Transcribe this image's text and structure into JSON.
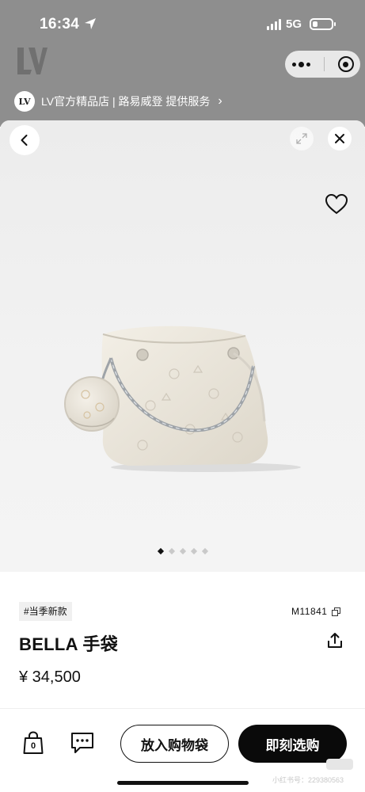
{
  "status_bar": {
    "time": "16:34",
    "network": "5G"
  },
  "mini_program": {
    "more_icon": "more-dots-icon",
    "close_icon": "target-ring-icon"
  },
  "service": {
    "badge": "LV",
    "text": "LV官方精品店 | 路易威登 提供服务",
    "chevron": "›"
  },
  "gallery": {
    "image_count": 5,
    "active_index": 0
  },
  "product": {
    "tag": "#当季新款",
    "sku": "M11841",
    "title": "BELLA 手袋",
    "price": "¥ 34,500"
  },
  "footer": {
    "cart_count": "0",
    "add_to_cart_label": "放入购物袋",
    "buy_now_label": "即刻选购"
  },
  "watermark": {
    "text": "小红书号：229380563"
  },
  "colors": {
    "backdrop": "#8e8e8e",
    "primary": "#0a0a0a",
    "gallery_bg": "#efefef"
  }
}
